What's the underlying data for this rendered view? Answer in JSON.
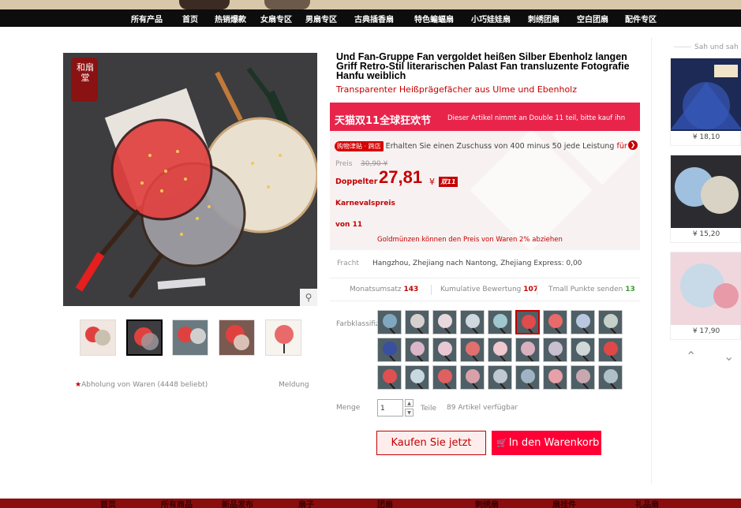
{
  "nav": {
    "items": [
      "所有产品",
      "首页",
      "热销爆款",
      "女扇专区",
      "男扇专区",
      "古典插香扇",
      "特色蝙蝠扇",
      "小巧娃娃扇",
      "刺绣团扇",
      "空白团扇",
      "配件专区"
    ]
  },
  "gallery": {
    "thumbnail_count": 5,
    "collect_label": "Abholung von",
    "collect_count": "Waren (4448 beliebt)",
    "report_label": "Meldung",
    "seal_text": "和扇堂"
  },
  "product": {
    "title": "Und Fan-Gruppe Fan vergoldet heißen Silber Ebenholz langen Griff Retro-Stil literarischen Palast Fan transluzente Fotografie Hanfu weiblich",
    "subtitle": "Transparenter Heißprägefächer aus Ulme und Ebenholz"
  },
  "promo": {
    "banner_title": "天猫双11全球狂欢节",
    "banner_text": "Dieser Artikel nimmt an Double 11 teil, bitte kauf ihn"
  },
  "coupon": {
    "tag": "购物津贴 · 跨店",
    "text": "Erhalten Sie einen Zuschuss von 400 minus 50 jede Leistung",
    "more": "für"
  },
  "price": {
    "label": "Preis",
    "old": "30,90 ¥",
    "double_label": "Doppelter",
    "new": "27,81",
    "currency": "¥",
    "icon_text": "双11",
    "carnival_label": "Karnevalspreis",
    "from_label": "von 11",
    "coins_text": "Goldmünzen können den Preis von Waren 2% abziehen"
  },
  "freight": {
    "label": "Fracht",
    "text": "Hangzhou, Zhejiang  nach Nantong, Zhejiang Express: 0,00"
  },
  "stats": {
    "monthly_label": "Monatsumsatz",
    "monthly_value": "143",
    "reviews_label": "Kumulative Bewertung",
    "reviews_value": "107",
    "points_label": "Tmall Punkte senden",
    "points_value": "13"
  },
  "colors": {
    "label": "Farbklassifizi",
    "swatch_count": 27,
    "selected_index": 5
  },
  "quantity": {
    "label": "Menge",
    "value": "1",
    "unit": "Teile",
    "stock": "89 Artikel verfügbar"
  },
  "actions": {
    "buy_label": "Kaufen Sie jetzt",
    "cart_label": "In den Warenkorb leg"
  },
  "sidebar": {
    "title": "Sah und sah",
    "items": [
      {
        "price": "¥ 18,10"
      },
      {
        "price": "¥ 15,20"
      },
      {
        "price": "¥ 17,90"
      }
    ]
  },
  "footer": {
    "items": [
      "首页",
      "所有商品",
      "新品发布",
      "扇子",
      "团扇",
      "刺绣扇",
      "扇挂件",
      "礼品扇"
    ]
  },
  "colors_theme": {
    "accent": "#c40000",
    "cart": "#ff0036",
    "nav_bg": "#0d0d0d"
  }
}
